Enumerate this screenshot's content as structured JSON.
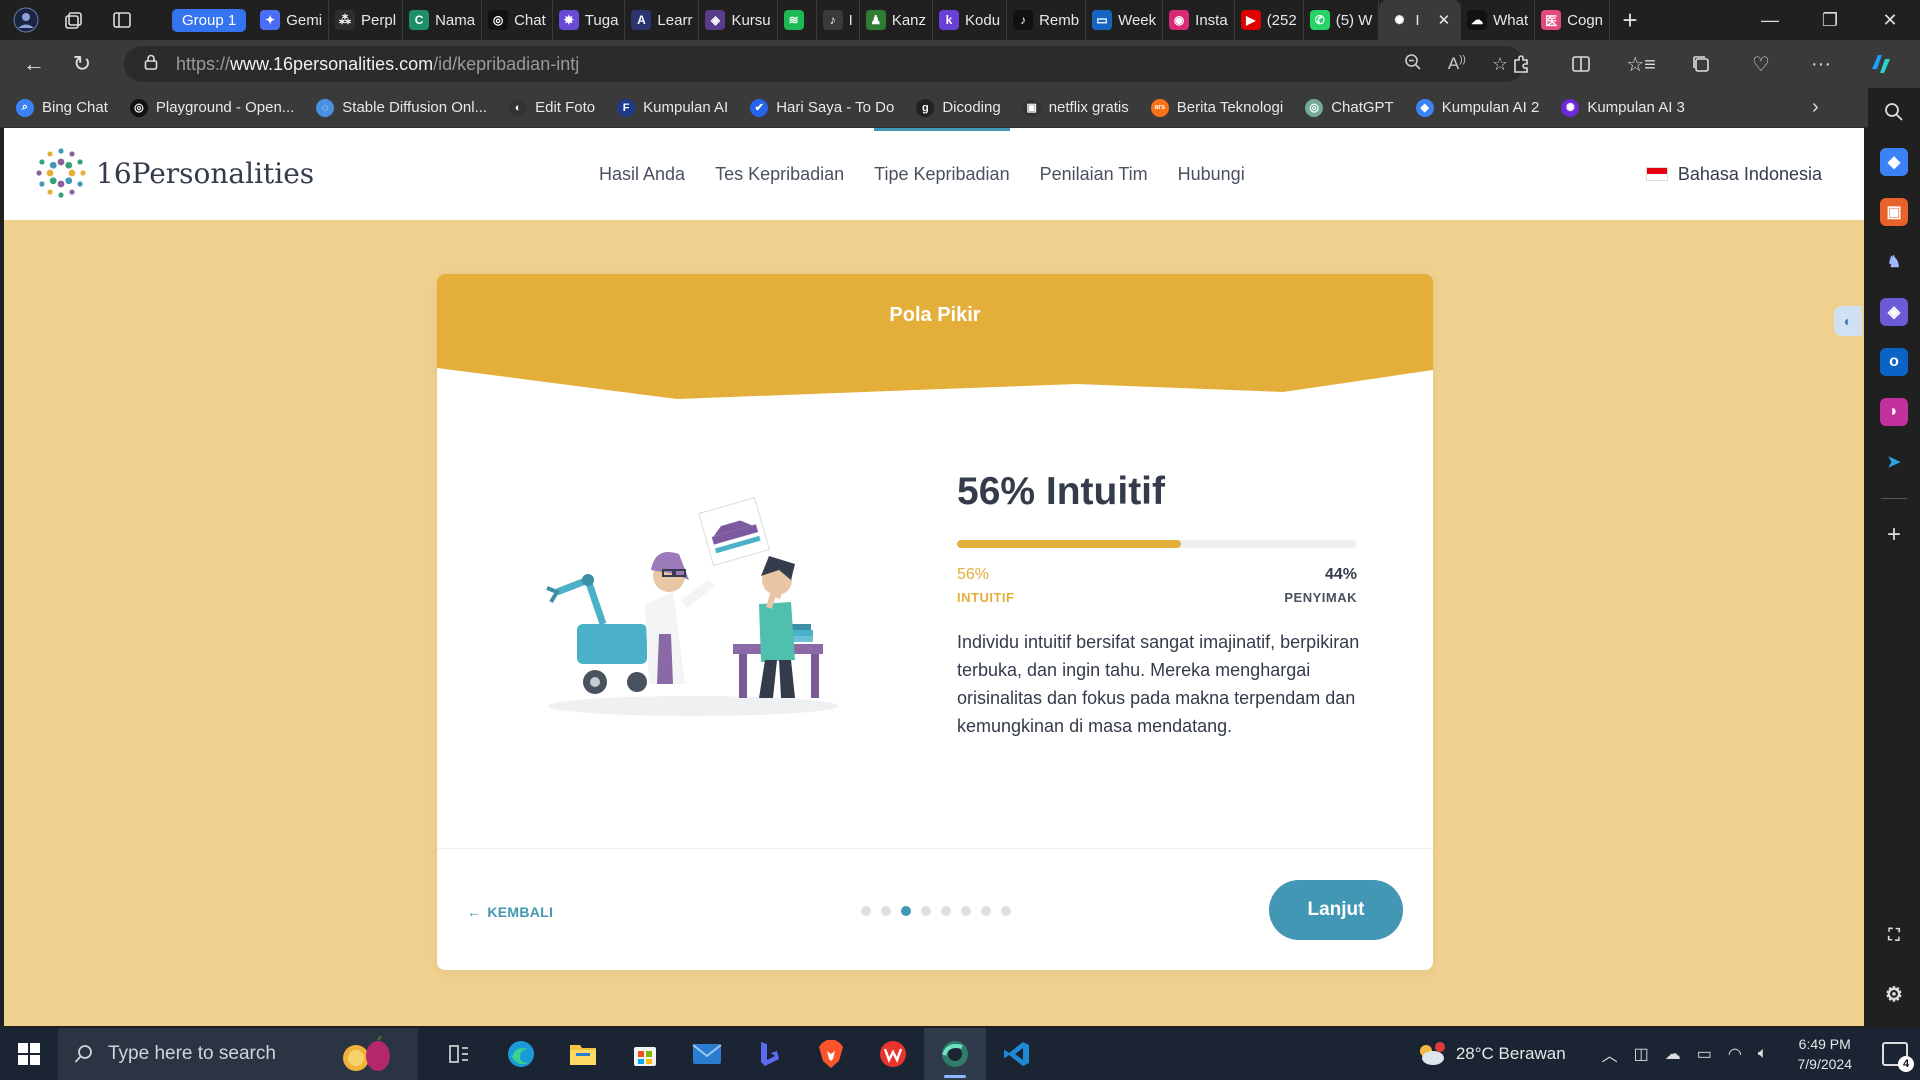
{
  "browser": {
    "tab_group": "Group 1",
    "tabs": [
      {
        "label": "Gemi",
        "color": "#4a6cf7",
        "glyph": "✦"
      },
      {
        "label": "Perpl",
        "color": "#2e2e2e",
        "glyph": "⁂"
      },
      {
        "label": "Nama",
        "color": "#1d8f6a",
        "glyph": "C"
      },
      {
        "label": "Chat",
        "color": "#111111",
        "glyph": "◎"
      },
      {
        "label": "Tuga",
        "color": "#6b4ad8",
        "glyph": "✸"
      },
      {
        "label": "Learr",
        "color": "#2c3470",
        "glyph": "A"
      },
      {
        "label": "Kursu",
        "color": "#5a3b8c",
        "glyph": "◈"
      },
      {
        "label": "",
        "color": "#1db954",
        "glyph": "≋"
      },
      {
        "label": "I",
        "color": "#3a3a3a",
        "glyph": "♪"
      },
      {
        "label": "Kanz",
        "color": "#2e7d32",
        "glyph": "♟"
      },
      {
        "label": "Kodu",
        "color": "#6a3fd6",
        "glyph": "k"
      },
      {
        "label": "Remb",
        "color": "#111111",
        "glyph": "♪"
      },
      {
        "label": "Week",
        "color": "#1565c0",
        "glyph": "▭"
      },
      {
        "label": "Insta",
        "color": "#d62976",
        "glyph": "◉"
      },
      {
        "label": "(252",
        "color": "#e00000",
        "glyph": "▶"
      },
      {
        "label": "(5) W",
        "color": "#25d366",
        "glyph": "✆"
      },
      {
        "label": "I",
        "color": "#3a3a3a",
        "glyph": "✺",
        "active": true
      },
      {
        "label": "What",
        "color": "#111111",
        "glyph": "☁"
      },
      {
        "label": "Cogn",
        "color": "#e24a7a",
        "glyph": "医"
      }
    ],
    "url": {
      "prefix": "https://",
      "host": "www.16personalities.com",
      "path": "/id/kepribadian-intj"
    },
    "bookmarks": [
      {
        "label": "Bing Chat",
        "color": "#3b82f6",
        "glyph": "⌕"
      },
      {
        "label": "Playground - Open...",
        "color": "#111111",
        "glyph": "◎"
      },
      {
        "label": "Stable Diffusion Onl...",
        "color": "#4a90e2",
        "glyph": "◌"
      },
      {
        "label": "Edit Foto",
        "color": "#333333",
        "glyph": "◐"
      },
      {
        "label": "Kumpulan AI",
        "color": "#1e3a8a",
        "glyph": "F"
      },
      {
        "label": "Hari Saya - To Do",
        "color": "#2563eb",
        "glyph": "✔"
      },
      {
        "label": "Dicoding",
        "color": "#222222",
        "glyph": "g"
      },
      {
        "label": "netflix gratis",
        "color": "#333333",
        "glyph": "▣"
      },
      {
        "label": "Berita Teknologi",
        "color": "#f97316",
        "glyph": "ars"
      },
      {
        "label": "ChatGPT",
        "color": "#74aa9c",
        "glyph": "◎"
      },
      {
        "label": "Kumpulan AI 2",
        "color": "#3b82f6",
        "glyph": "◆"
      },
      {
        "label": "Kumpulan AI 3",
        "color": "#6d28d9",
        "glyph": "✺"
      }
    ]
  },
  "site": {
    "logo_text": "16Personalities",
    "nav": [
      {
        "label": "Hasil Anda"
      },
      {
        "label": "Tes Kepribadian"
      },
      {
        "label": "Tipe Kepribadian",
        "active": true
      },
      {
        "label": "Penilaian Tim"
      },
      {
        "label": "Hubungi"
      }
    ],
    "language": "Bahasa Indonesia"
  },
  "card": {
    "title": "Pola Pikir",
    "trait_heading": "56% Intuitif",
    "bar_fraction": 0.56,
    "left_percent": "56%",
    "left_label": "INTUITIF",
    "right_percent": "44%",
    "right_label": "PENYIMAK",
    "description": "Individu intuitif bersifat sangat imajinatif, berpikiran terbuka, dan ingin tahu. Mereka menghargai orisinalitas dan fokus pada makna terpendam dan kemungkinan di masa mendatang.",
    "back_label": "KEMBALI",
    "next_label": "Lanjut",
    "dots_total": 8,
    "dots_active_index": 2
  },
  "colors": {
    "page_bg": "#f0d08e",
    "card_header": "#e4ae3a",
    "accent_blue": "#4298b4"
  },
  "taskbar": {
    "search_placeholder": "Type here to search",
    "weather": "28°C  Berawan",
    "time": "6:49 PM",
    "date": "7/9/2024",
    "notifications": "4"
  }
}
